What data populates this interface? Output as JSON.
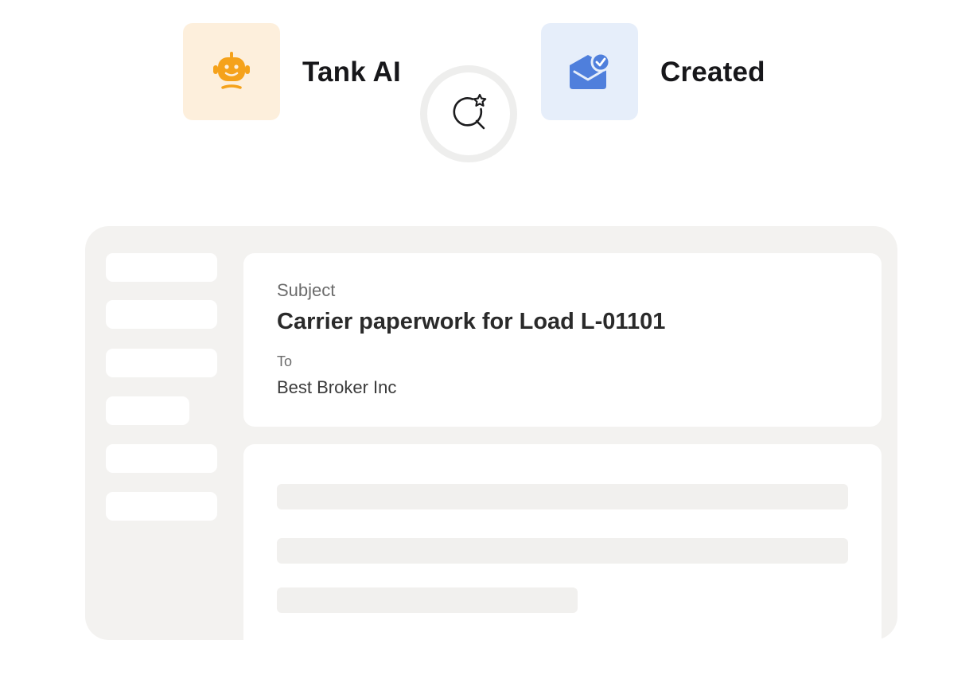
{
  "header": {
    "agent": {
      "name": "Tank AI",
      "icon": "robot-icon",
      "tile_color": "#fdefdc",
      "icon_color": "#f5a21b"
    },
    "connector": {
      "icon": "search-sparkle-icon"
    },
    "status": {
      "label": "Created",
      "icon": "mail-check-icon",
      "tile_color": "#e6eefa",
      "icon_color": "#4f7fdc"
    }
  },
  "email": {
    "subject_label": "Subject",
    "subject": "Carrier paperwork for Load L-01101",
    "to_label": "To",
    "to": "Best Broker Inc"
  }
}
